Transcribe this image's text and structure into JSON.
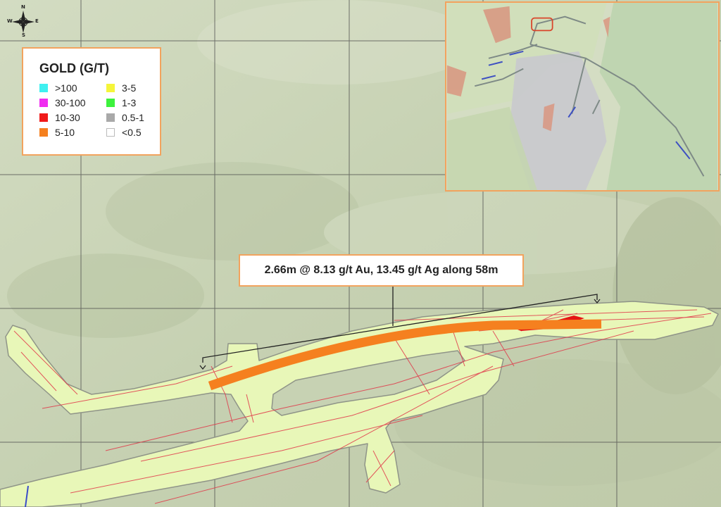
{
  "compass": {
    "north": "N",
    "south": "S",
    "east": "E",
    "west": "W"
  },
  "legend": {
    "title": "GOLD (G/T)",
    "items": [
      {
        "label": ">100",
        "color": "#3ff0f0"
      },
      {
        "label": "30-100",
        "color": "#f02cf0"
      },
      {
        "label": "10-30",
        "color": "#f01a1a"
      },
      {
        "label": "5-10",
        "color": "#f5801f"
      },
      {
        "label": "3-5",
        "color": "#f5f53a"
      },
      {
        "label": "1-3",
        "color": "#3df23d"
      },
      {
        "label": "0.5-1",
        "color": "#a9a9a9"
      },
      {
        "label": "<0.5",
        "color": "#ffffff"
      }
    ]
  },
  "callout": {
    "text": "2.66m @ 8.13 g/t Au, 13.45 g/t Ag along 58m"
  },
  "colors": {
    "terrain": "#c9d4b6",
    "workings_fill": "#e8f7b8",
    "workings_edge": "#8f9488",
    "grid": "#4a4a4a",
    "intercept": "#f5801f",
    "veins": "#e0394a",
    "frame": "#f2a35e"
  }
}
